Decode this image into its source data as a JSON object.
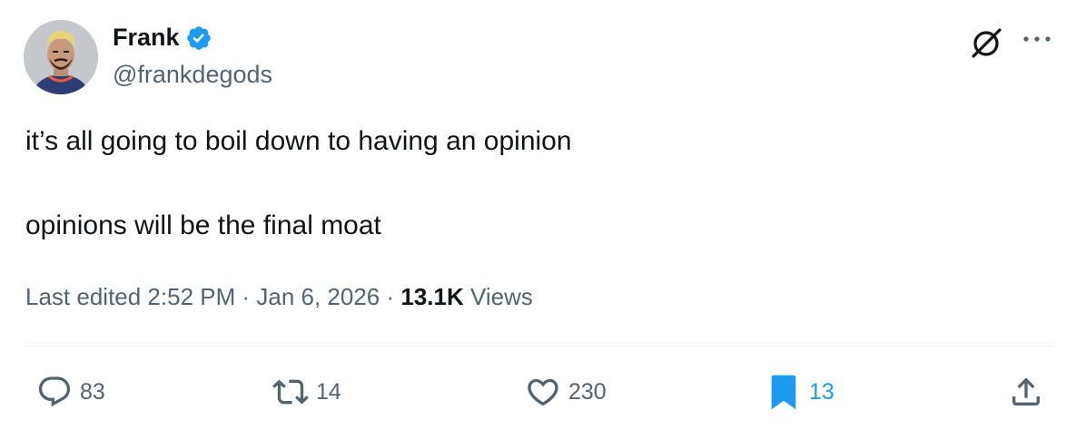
{
  "author": {
    "display_name": "Frank",
    "handle": "@frankdegods",
    "verified": true,
    "verified_color": "#1d9bf0",
    "avatar_icon": "avatar-cartoon-man-blonde-hair"
  },
  "header_icons": {
    "grok": "grok-icon",
    "more": "more-options-icon"
  },
  "tweet": {
    "lines": [
      "it’s all going to boil down to having an opinion",
      "opinions will be the final moat"
    ]
  },
  "meta": {
    "edited_prefix": "Last edited 2:52 PM · Jan 6, 2026 · ",
    "views_count": "13.1K",
    "views_label": " Views"
  },
  "actions": {
    "replies": "83",
    "reposts": "14",
    "likes": "230",
    "bookmarks": "13",
    "bookmark_active_color": "#1d9bf0"
  },
  "colors": {
    "text_primary": "#0f1419",
    "text_secondary": "#536471",
    "accent": "#1d9bf0"
  }
}
